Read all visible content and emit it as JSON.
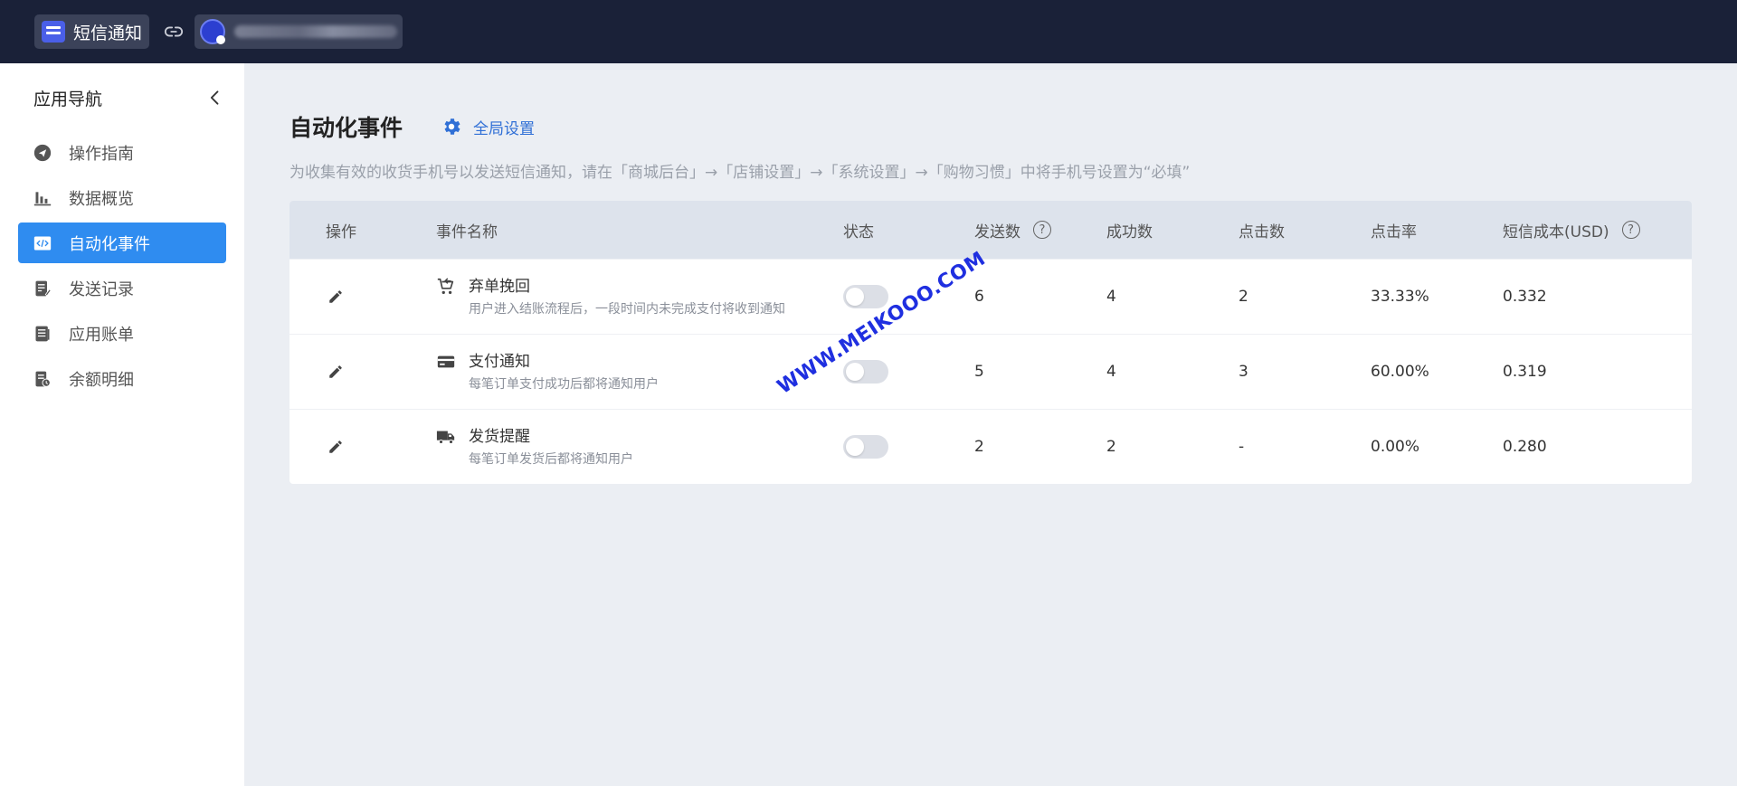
{
  "topbar": {
    "app_name": "短信通知",
    "store_name": "",
    "colors": {
      "bg": "#1a2138",
      "chip": "#3b4259",
      "logo": "#4a5fe8"
    }
  },
  "sidebar": {
    "title": "应用导航",
    "items": [
      {
        "label": "操作指南",
        "icon": "send-icon",
        "active": false
      },
      {
        "label": "数据概览",
        "icon": "bar-chart-icon",
        "active": false
      },
      {
        "label": "自动化事件",
        "icon": "code-icon",
        "active": true
      },
      {
        "label": "发送记录",
        "icon": "edit-doc-icon",
        "active": false
      },
      {
        "label": "应用账单",
        "icon": "document-icon",
        "active": false
      },
      {
        "label": "余额明细",
        "icon": "balance-doc-icon",
        "active": false
      }
    ],
    "colors": {
      "active_bg": "#2f8cf0"
    }
  },
  "main": {
    "title": "自动化事件",
    "global_settings": "全局设置",
    "description": "为收集有效的收货手机号以发送短信通知，请在「商城后台」→「店铺设置」→「系统设置」→「购物习惯」中将手机号设置为“必填”",
    "table": {
      "headers": {
        "op": "操作",
        "name": "事件名称",
        "status": "状态",
        "sent": "发送数",
        "success": "成功数",
        "clicks": "点击数",
        "rate": "点击率",
        "cost": "短信成本(USD)"
      },
      "rows": [
        {
          "icon": "cart-return-icon",
          "name": "弃单挽回",
          "desc": "用户进入结账流程后，一段时间内未完成支付将收到通知",
          "enabled": false,
          "sent": "6",
          "success": "4",
          "clicks": "2",
          "rate": "33.33%",
          "cost": "0.332"
        },
        {
          "icon": "credit-card-icon",
          "name": "支付通知",
          "desc": "每笔订单支付成功后都将通知用户",
          "enabled": false,
          "sent": "5",
          "success": "4",
          "clicks": "3",
          "rate": "60.00%",
          "cost": "0.319"
        },
        {
          "icon": "truck-icon",
          "name": "发货提醒",
          "desc": "每笔订单发货后都将通知用户",
          "enabled": false,
          "sent": "2",
          "success": "2",
          "clicks": "-",
          "rate": "0.00%",
          "cost": "0.280"
        }
      ]
    }
  },
  "watermark": "WWW.MEIKOOO.COM"
}
